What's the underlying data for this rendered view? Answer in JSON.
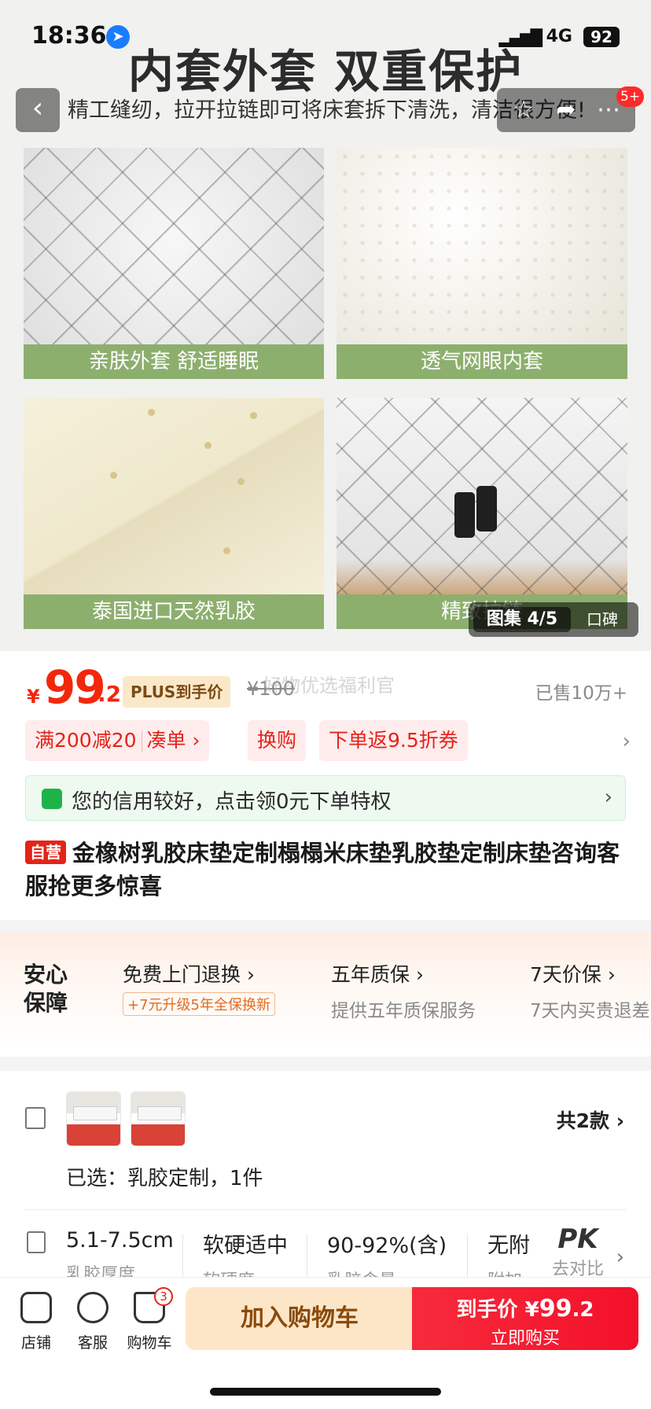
{
  "status_bar": {
    "time": "18:36",
    "network": "4G",
    "battery": "92"
  },
  "nav": {
    "back_icon": "chevron-left-icon",
    "favorite_icon": "star-icon",
    "share_icon": "share-icon",
    "more_icon": "more-icon",
    "badge": "5+"
  },
  "gallery": {
    "headline": "内套外套 双重保护",
    "subline": "精工缝纫，拉开拉链即可将床套拆下清洗，清洁很方便!",
    "tiles": [
      {
        "caption": "亲肤外套 舒适睡眠"
      },
      {
        "caption": "透气网眼内套"
      },
      {
        "caption": "泰国进口天然乳胶"
      },
      {
        "caption": "精致拉链 "
      }
    ],
    "counter": "图集 4/5",
    "reviews_tab": "口碑"
  },
  "price": {
    "currency": "¥",
    "integer": "99",
    "decimal": ".2",
    "plus_label": "PLUS到手价",
    "original": "¥100",
    "watermark": "好物优选福利官",
    "sold": "已售10万+"
  },
  "promos": {
    "coupon": "满200减20",
    "coupon_action": "凑单 ›",
    "swap": "换购",
    "rebate": "下单返9.5折券",
    "chevron": "›"
  },
  "credit": {
    "text": "您的信用较好，点击领0元下单特权",
    "chevron": "›"
  },
  "product": {
    "self_tag": "自营",
    "title": "金橡树乳胶床垫定制榻榻米床垫乳胶垫定制床垫咨询客服抢更多惊喜"
  },
  "guarantee": {
    "badge_line1": "安心",
    "badge_line2": "保障",
    "items": [
      {
        "title": "免费上门退换 ›",
        "upgrade": "+7元升级5年全保换新"
      },
      {
        "title": "五年质保 ›",
        "sub": "提供五年质保服务"
      },
      {
        "title": "7天价保 ›",
        "sub": "7天内买贵退差"
      }
    ]
  },
  "sku": {
    "count": "共2款 ›",
    "selected_label": "已选：",
    "selected_value": "乳胶定制，1件"
  },
  "specs": {
    "items": [
      {
        "value": "5.1-7.5cm",
        "key": "乳胶厚度"
      },
      {
        "value": "软硬适中",
        "key": "软硬度"
      },
      {
        "value": "90-92%(含)",
        "key": "乳胶含量"
      },
      {
        "value": "无附",
        "key": "附加"
      }
    ],
    "pk_title": "PK",
    "pk_sub": "去对比",
    "chevron": "›"
  },
  "bottom_bar": {
    "shop": "店铺",
    "service": "客服",
    "cart": "购物车",
    "cart_badge": "3",
    "add_to_cart": "加入购物车",
    "buy_price_label": "到手价",
    "buy_currency": "¥",
    "buy_price": "99",
    "buy_price_decimal": ".2",
    "buy_now": "立即购买"
  },
  "colors": {
    "accent": "#f2270c",
    "buy_button": "#f4102a",
    "cart_button": "#fde6c8",
    "caption_green": "#8daf6e"
  }
}
